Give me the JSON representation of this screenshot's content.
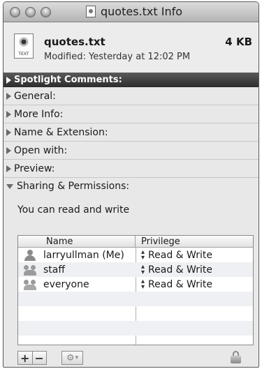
{
  "window": {
    "title": "quotes.txt Info",
    "file_name": "quotes.txt",
    "file_size": "4 KB",
    "modified": "Modified: Yesterday at 12:02 PM",
    "file_type_label": "TEXT"
  },
  "sections": {
    "spotlight": "Spotlight Comments:",
    "general": "General:",
    "more_info": "More Info:",
    "name_extension": "Name & Extension:",
    "open_with": "Open with:",
    "preview": "Preview:",
    "sharing": "Sharing & Permissions:"
  },
  "permissions": {
    "message": "You can read and write",
    "columns": {
      "name": "Name",
      "privilege": "Privilege"
    },
    "rows": [
      {
        "name": "larryullman (Me)",
        "privilege": "Read & Write",
        "icon": "user-icon"
      },
      {
        "name": "staff",
        "privilege": "Read & Write",
        "icon": "group-icon"
      },
      {
        "name": "everyone",
        "privilege": "Read & Write",
        "icon": "everyone-icon"
      }
    ]
  },
  "toolbar": {
    "add_label": "+",
    "remove_label": "−",
    "gear_glyph": "⚙",
    "gear_arrow": "▾"
  }
}
